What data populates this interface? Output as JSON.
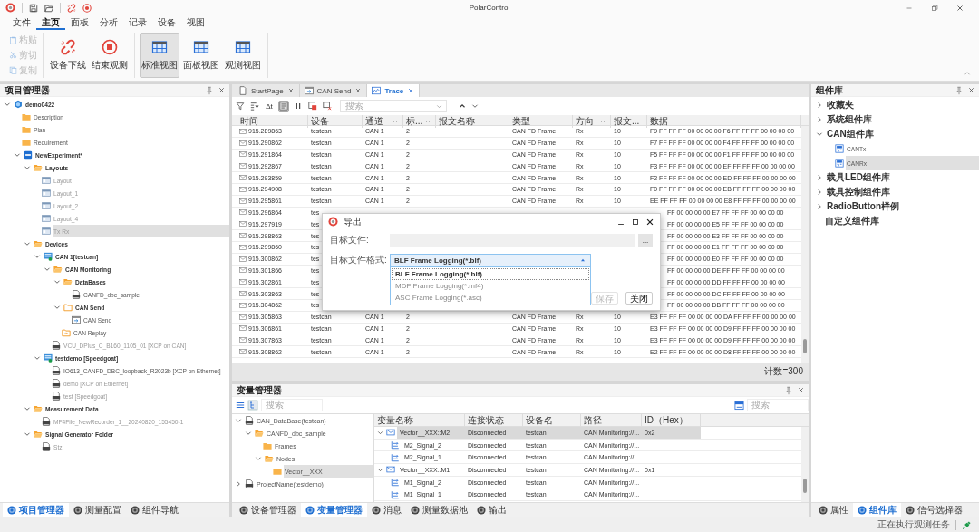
{
  "window": {
    "title": "PolarControl"
  },
  "menu": [
    {
      "label": "文件",
      "selected": false
    },
    {
      "label": "主页",
      "selected": true
    },
    {
      "label": "面板",
      "selected": false
    },
    {
      "label": "分析",
      "selected": false
    },
    {
      "label": "记录",
      "selected": false
    },
    {
      "label": "设备",
      "selected": false
    },
    {
      "label": "视图",
      "selected": false
    }
  ],
  "ribbon": {
    "small_buttons": [
      {
        "label": "粘贴",
        "kind": "paste",
        "disabled": true
      },
      {
        "label": "剪切",
        "kind": "cut",
        "disabled": true
      },
      {
        "label": "复制",
        "kind": "copy",
        "disabled": true
      }
    ],
    "large_buttons": [
      {
        "label": "设备下线",
        "kind": "offline",
        "selected": false
      },
      {
        "label": "结束观测",
        "kind": "stop",
        "selected": false
      },
      {
        "label": "标准视图",
        "kind": "view",
        "selected": true
      },
      {
        "label": "面板视图",
        "kind": "view",
        "selected": false
      },
      {
        "label": "观测视图",
        "kind": "view",
        "selected": false
      }
    ]
  },
  "project_panel": {
    "title": "项目管理器",
    "tree": [
      {
        "label": "demo0422",
        "kind": "project",
        "expanded": true,
        "selected": false,
        "disabled": false,
        "children": [
          {
            "label": "Description",
            "kind": "folder",
            "selected": false,
            "disabled": false
          },
          {
            "label": "Plan",
            "kind": "folder",
            "selected": false,
            "disabled": false
          },
          {
            "label": "Requirement",
            "kind": "folder",
            "selected": false,
            "disabled": false
          },
          {
            "label": "NewExperiment*",
            "kind": "experiment",
            "expanded": true,
            "selected": false,
            "disabled": false,
            "children": [
              {
                "label": "Layouts",
                "kind": "folder_open",
                "expanded": true,
                "selected": false,
                "disabled": false,
                "children": [
                  {
                    "label": "Layout",
                    "kind": "layout",
                    "selected": false,
                    "disabled": true
                  },
                  {
                    "label": "Layout_1",
                    "kind": "layout",
                    "selected": false,
                    "disabled": true
                  },
                  {
                    "label": "Layout_2",
                    "kind": "layout",
                    "selected": false,
                    "disabled": true
                  },
                  {
                    "label": "Layout_4",
                    "kind": "layout",
                    "selected": false,
                    "disabled": true
                  },
                  {
                    "label": "Tx Rx",
                    "kind": "layout",
                    "selected": true,
                    "disabled": true
                  }
                ]
              },
              {
                "label": "Devices",
                "kind": "folder_open",
                "expanded": true,
                "selected": false,
                "disabled": false,
                "children": [
                  {
                    "label": "CAN 1[testcan]",
                    "kind": "device",
                    "expanded": true,
                    "selected": false,
                    "disabled": false,
                    "children": [
                      {
                        "label": "CAN Monitoring",
                        "kind": "folder_open",
                        "expanded": true,
                        "selected": false,
                        "disabled": false,
                        "children": [
                          {
                            "label": "DataBases",
                            "kind": "folder_open",
                            "expanded": true,
                            "selected": false,
                            "disabled": false,
                            "children": [
                              {
                                "label": "CANFD_dbc_sample",
                                "kind": "doc",
                                "selected": false,
                                "disabled": false
                              }
                            ]
                          },
                          {
                            "label": "CAN Send",
                            "kind": "folder_outline",
                            "expanded": true,
                            "selected": false,
                            "disabled": false,
                            "children": [
                              {
                                "label": "CAN Send",
                                "kind": "send",
                                "selected": false,
                                "disabled": false
                              }
                            ]
                          },
                          {
                            "label": "CAN Replay",
                            "kind": "replay_folder",
                            "selected": false,
                            "disabled": false
                          }
                        ]
                      },
                      {
                        "label": "VCU_DPlus_C_B160_1105_01 [XCP on CAN]",
                        "kind": "doc",
                        "selected": false,
                        "disabled": true
                      }
                    ]
                  },
                  {
                    "label": "testdemo [Speedgoat]",
                    "kind": "device",
                    "expanded": true,
                    "selected": false,
                    "disabled": false,
                    "children": [
                      {
                        "label": "IO613_CANFD_DBC_loopback_R2023b [XCP on Ethernet]",
                        "kind": "doc",
                        "selected": false,
                        "disabled": false
                      },
                      {
                        "label": "demo [XCP on Ethernet]",
                        "kind": "doc",
                        "selected": false,
                        "disabled": true
                      },
                      {
                        "label": "test [Speedgoat]",
                        "kind": "doc",
                        "selected": false,
                        "disabled": true
                      }
                    ]
                  }
                ]
              },
              {
                "label": "Measurement Data",
                "kind": "folder_open",
                "expanded": true,
                "selected": false,
                "disabled": false,
                "children": [
                  {
                    "label": "MF4File_NewRecorder_1__20240820_155450-1",
                    "kind": "doc",
                    "selected": false,
                    "disabled": true
                  }
                ]
              },
              {
                "label": "Signal Generator Folder",
                "kind": "folder_open",
                "expanded": true,
                "selected": false,
                "disabled": false,
                "children": [
                  {
                    "label": "Stz",
                    "kind": "doc",
                    "selected": false,
                    "disabled": true
                  }
                ]
              }
            ]
          }
        ]
      }
    ],
    "bottom_tabs": [
      {
        "label": "项目管理器",
        "selected": true
      },
      {
        "label": "测量配置",
        "selected": false
      },
      {
        "label": "组件导航",
        "selected": false
      }
    ]
  },
  "documents": {
    "tabs": [
      {
        "label": "StartPage",
        "kind": "page",
        "selected": false
      },
      {
        "label": "CAN Send",
        "kind": "send",
        "selected": false
      },
      {
        "label": "Trace",
        "kind": "trace",
        "selected": true
      }
    ],
    "toolbar": [
      {
        "kind": "filter",
        "pressed": false
      },
      {
        "kind": "column_filter",
        "pressed": false
      },
      {
        "kind": "delta",
        "label": "Δt",
        "pressed": false
      },
      {
        "kind": "list",
        "pressed": true
      },
      {
        "kind": "pause",
        "pressed": false
      },
      {
        "kind": "export",
        "pressed": false
      },
      {
        "kind": "clear",
        "pressed": false
      }
    ],
    "search": {
      "placeholder": "搜索"
    },
    "columns": [
      {
        "label": "时间",
        "sort_arrow": false
      },
      {
        "label": "设备",
        "sort_arrow": false
      },
      {
        "label": "通道",
        "sort_arrow": true
      },
      {
        "label": "标...",
        "sort_arrow": true
      },
      {
        "label": "报文名称",
        "sort_arrow": false
      },
      {
        "label": "类型",
        "sort_arrow": false
      },
      {
        "label": "方向",
        "sort_arrow": true
      },
      {
        "label": "报文...",
        "sort_arrow": false
      },
      {
        "label": "数据",
        "sort_arrow": false
      }
    ],
    "rows": [
      {
        "time": "915.289863",
        "device": "testcan",
        "channel": "CAN 1",
        "id": "2",
        "type": "CAN FD Frame",
        "dir": "Rx",
        "len": "10",
        "data": "F9 FF FF FF 00 00 00 00 F6 FF FF FF 00 00 00 00",
        "covered": false
      },
      {
        "time": "915.290862",
        "device": "testcan",
        "channel": "CAN 1",
        "id": "2",
        "type": "CAN FD Frame",
        "dir": "Rx",
        "len": "10",
        "data": "F7 FF FF FF 00 00 00 00 F4 FF FF FF 00 00 00 00",
        "covered": false
      },
      {
        "time": "915.291864",
        "device": "testcan",
        "channel": "CAN 1",
        "id": "2",
        "type": "CAN FD Frame",
        "dir": "Rx",
        "len": "10",
        "data": "F5 FF FF FF 00 00 00 00 F1 FF FF FF 00 00 00 00",
        "covered": false
      },
      {
        "time": "915.292867",
        "device": "testcan",
        "channel": "CAN 1",
        "id": "2",
        "type": "CAN FD Frame",
        "dir": "Rx",
        "len": "10",
        "data": "F3 FF FF FF 00 00 00 00 EF FF FF FF 00 00 00 00",
        "covered": false
      },
      {
        "time": "915.293859",
        "device": "testcan",
        "channel": "CAN 1",
        "id": "2",
        "type": "CAN FD Frame",
        "dir": "Rx",
        "len": "10",
        "data": "F2 FF FF FF 00 00 00 00 ED FF FF FF 00 00 00 00",
        "covered": false
      },
      {
        "time": "915.294908",
        "device": "testcan",
        "channel": "CAN 1",
        "id": "2",
        "type": "CAN FD Frame",
        "dir": "Rx",
        "len": "10",
        "data": "F0 FF FF FF 00 00 00 00 EB FF FF FF 00 00 00 00",
        "covered": false
      },
      {
        "time": "915.295861",
        "device": "testcan",
        "channel": "CAN 1",
        "id": "2",
        "type": "CAN FD Frame",
        "dir": "Rx",
        "len": "10",
        "data": "EE FF FF FF 00 00 00 00 E8 FF FF FF 00 00 00 00",
        "covered": false
      },
      {
        "time": "915.296864",
        "device": "tes",
        "data": "FF 00 00 00 00 E7 FF FF FF 00 00 00 00",
        "covered": true
      },
      {
        "time": "915.297919",
        "device": "tes",
        "data": "FF 00 00 00 00 E5 FF FF FF 00 00 00 00",
        "covered": true
      },
      {
        "time": "915.298863",
        "device": "tes",
        "data": "FF 00 00 00 00 E3 FF FF FF 00 00 00 00",
        "covered": true
      },
      {
        "time": "915.299860",
        "device": "tes",
        "data": "FF 00 00 00 00 E1 FF FF FF 00 00 00 00",
        "covered": true
      },
      {
        "time": "915.300862",
        "device": "tes",
        "data": "FF 00 00 00 00 E0 FF FF FF 00 00 00 00",
        "covered": true
      },
      {
        "time": "915.301866",
        "device": "tes",
        "data": "FF 00 00 00 00 DE FF FF FF 00 00 00 00",
        "covered": true
      },
      {
        "time": "915.302861",
        "device": "tes",
        "data": "FF 00 00 00 00 DD FF FF FF 00 00 00 00",
        "covered": true
      },
      {
        "time": "915.303863",
        "device": "tes",
        "data": "FF 00 00 00 00 DC FF FF FF 00 00 00 00",
        "covered": true
      },
      {
        "time": "915.304862",
        "device": "tes",
        "data": "FF 00 00 00 00 DB FF FF FF 00 00 00 00",
        "covered": true
      },
      {
        "time": "915.305863",
        "device": "testcan",
        "channel": "CAN 1",
        "id": "2",
        "type": "CAN FD Frame",
        "dir": "Rx",
        "len": "10",
        "data": "E3 FF FF FF 00 00 00 00 DA FF FF FF 00 00 00 00",
        "covered": false
      },
      {
        "time": "915.306861",
        "device": "testcan",
        "channel": "CAN 1",
        "id": "2",
        "type": "CAN FD Frame",
        "dir": "Rx",
        "len": "10",
        "data": "E3 FF FF FF 00 00 00 00 D9 FF FF FF 00 00 00 00",
        "covered": false
      },
      {
        "time": "915.307863",
        "device": "testcan",
        "channel": "CAN 1",
        "id": "2",
        "type": "CAN FD Frame",
        "dir": "Rx",
        "len": "10",
        "data": "E3 FF FF FF 00 00 00 00 D9 FF FF FF 00 00 00 00",
        "covered": false
      },
      {
        "time": "915.308862",
        "device": "testcan",
        "channel": "CAN 1",
        "id": "2",
        "type": "CAN FD Frame",
        "dir": "Rx",
        "len": "10",
        "data": "E2 FF FF FF 00 00 00 00 D8 FF FF FF 00 00 00 00",
        "covered": false
      }
    ],
    "count": "计数=300"
  },
  "export_dialog": {
    "title": "导出",
    "file_label": "目标文件:",
    "browse": "...",
    "format_label": "目标文件格式:",
    "format_value": "BLF Frame Logging(*.blf)",
    "options": [
      {
        "label": "BLF Frame Logging(*.blf)",
        "selected": true
      },
      {
        "label": "MDF Frame Logging(*.mf4)",
        "selected": false
      },
      {
        "label": "ASC Frame Logging(*.asc)",
        "selected": false
      }
    ],
    "buttons": [
      {
        "label": "保存",
        "disabled": true
      },
      {
        "label": "关闭",
        "disabled": false
      }
    ]
  },
  "variable_panel": {
    "title": "变量管理器",
    "search_left": {
      "placeholder": "搜索"
    },
    "search_right": {
      "placeholder": "搜索"
    },
    "tree": [
      {
        "label": "CAN_DataBase(testcan)",
        "kind": "doc",
        "expanded": true,
        "selected": false,
        "children": [
          {
            "label": "CANFD_dbc_sample",
            "kind": "folder_open",
            "expanded": true,
            "selected": false,
            "children": [
              {
                "label": "Frames",
                "kind": "folder",
                "selected": false
              },
              {
                "label": "Nodes",
                "kind": "folder_open",
                "expanded": true,
                "selected": false,
                "children": [
                  {
                    "label": "Vector__XXX",
                    "kind": "folder",
                    "selected": true
                  }
                ]
              }
            ]
          }
        ]
      },
      {
        "label": "ProjectName(testdemo)",
        "kind": "doc",
        "expanded": false,
        "selected": false
      }
    ],
    "columns": [
      "变量名称",
      "连接状态",
      "设备名",
      "路径",
      "ID（Hex）"
    ],
    "rows": [
      {
        "name": "Vector__XXX::M2",
        "kind": "message",
        "expanded": true,
        "selected": true,
        "status": "Disconnected",
        "device": "testcan",
        "path": "CAN Monitoring://...",
        "id": "0x2",
        "children": [
          {
            "name": "M2_Signal_2",
            "kind": "signal",
            "selected": false,
            "status": "Disconnected",
            "device": "testcan",
            "path": "CAN Monitoring://..."
          },
          {
            "name": "M2_Signal_1",
            "kind": "signal",
            "selected": false,
            "status": "Disconnected",
            "device": "testcan",
            "path": "CAN Monitoring://..."
          }
        ]
      },
      {
        "name": "Vector__XXX::M1",
        "kind": "message",
        "expanded": true,
        "selected": false,
        "status": "Disconnected",
        "device": "testcan",
        "path": "CAN Monitoring://...",
        "id": "0x1",
        "children": [
          {
            "name": "M1_Signal_2",
            "kind": "signal",
            "selected": false,
            "status": "Disconnected",
            "device": "testcan",
            "path": "CAN Monitoring://..."
          },
          {
            "name": "M1_Signal_1",
            "kind": "signal",
            "selected": false,
            "status": "Disconnected",
            "device": "testcan",
            "path": "CAN Monitoring://..."
          }
        ]
      }
    ],
    "bottom_tabs": [
      {
        "label": "设备管理器",
        "selected": false
      },
      {
        "label": "变量管理器",
        "selected": true
      },
      {
        "label": "消息",
        "selected": false
      },
      {
        "label": "测量数据池",
        "selected": false
      },
      {
        "label": "输出",
        "selected": false
      }
    ]
  },
  "component_panel": {
    "title": "组件库",
    "tree": [
      {
        "label": "收藏夹",
        "expanded": false,
        "selected": false
      },
      {
        "label": "系统组件库",
        "expanded": false,
        "selected": false
      },
      {
        "label": "CAN组件库",
        "expanded": true,
        "selected": false,
        "children": [
          {
            "label": "CANTx",
            "kind": "component",
            "selected": false
          },
          {
            "label": "CANRx",
            "kind": "component",
            "selected": true
          }
        ]
      },
      {
        "label": "载具LED组件库",
        "expanded": false,
        "selected": false
      },
      {
        "label": "载具控制组件库",
        "expanded": false,
        "selected": false
      },
      {
        "label": "RadioButton样例",
        "expanded": false,
        "selected": false
      },
      {
        "label": "自定义组件库",
        "selected": false
      }
    ],
    "bottom_tabs": [
      {
        "label": "属性",
        "selected": false
      },
      {
        "label": "组件库",
        "selected": true
      },
      {
        "label": "信号选择器",
        "selected": false
      }
    ]
  },
  "status_bar": {
    "text": "正在执行观测任务"
  }
}
